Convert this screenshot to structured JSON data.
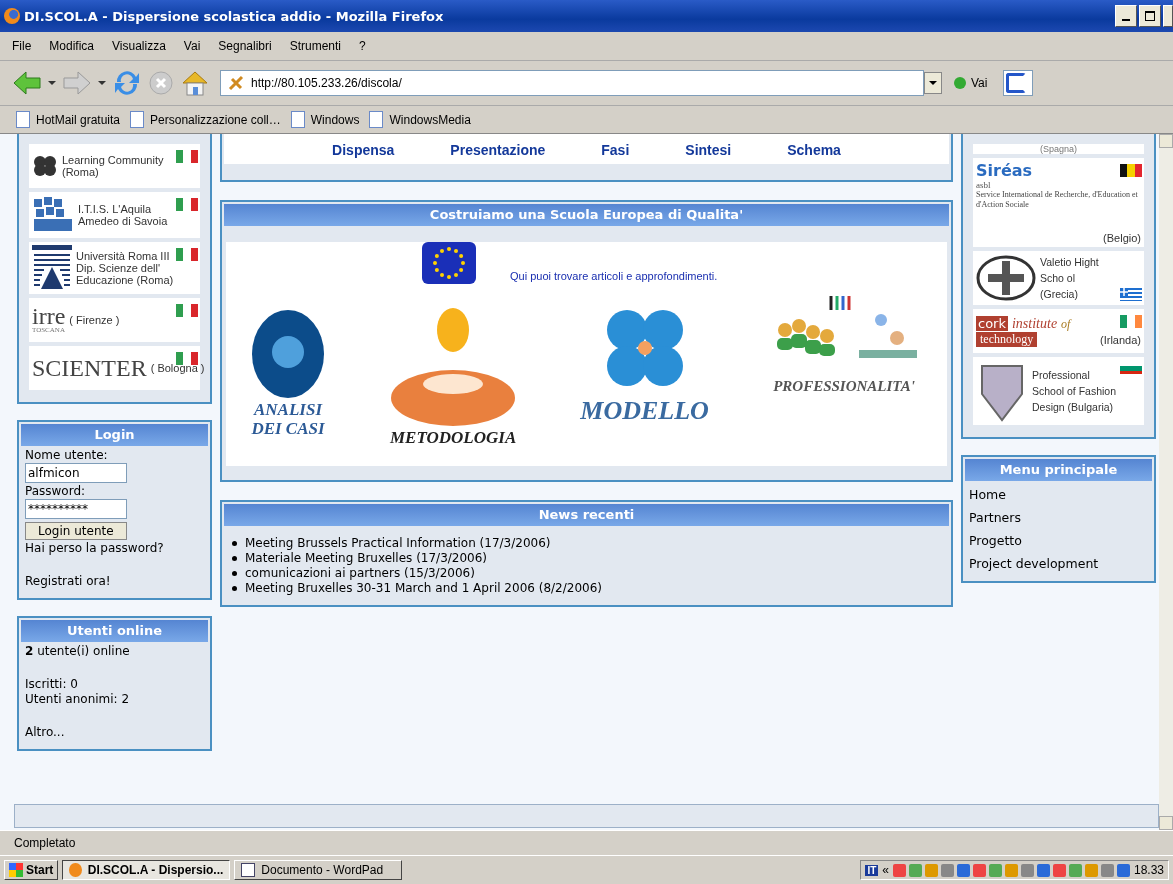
{
  "window": {
    "title": "DI.SCOL.A - Dispersione scolastica addio - Mozilla Firefox"
  },
  "menu": [
    "File",
    "Modifica",
    "Visualizza",
    "Vai",
    "Segnalibri",
    "Strumenti",
    "?"
  ],
  "address": {
    "url": "http://80.105.233.26/discola/",
    "go_label": "Vai"
  },
  "bookmarks": [
    "HotMail gratuita",
    "Personalizzazione coll…",
    "Windows",
    "WindowsMedia"
  ],
  "left_partners": [
    {
      "kind": "clover",
      "lines": [
        "Learning Community",
        "(Roma)"
      ],
      "flag": {
        "kind": "italy"
      }
    },
    {
      "kind": "blocks",
      "lines": [
        "I.T.I.S. L'Aquila",
        "Amedeo di Savoia"
      ],
      "flag": {
        "kind": "italy"
      }
    },
    {
      "kind": "arch",
      "lines": [
        "Università Roma III",
        "Dip. Scienze dell'",
        "Educazione (Roma)"
      ],
      "flag": {
        "kind": "italy"
      }
    },
    {
      "kind": "wordmark",
      "logo_text": [
        "irre",
        "TOSCANA"
      ],
      "lines": [
        "( Firenze )"
      ],
      "flag": {
        "kind": "italy"
      }
    },
    {
      "kind": "wordmark",
      "logo_text": [
        "SCIENTER"
      ],
      "lines": [
        "( Bologna )"
      ],
      "flag": {
        "kind": "italy"
      }
    }
  ],
  "login": {
    "title": "Login",
    "user_label": "Nome utente:",
    "user_value": "alfmicon",
    "password_label": "Password:",
    "password_value": "**********",
    "button": "Login utente",
    "lost_link": "Hai perso la password?",
    "register_link": "Registrati ora!"
  },
  "online": {
    "title": "Utenti online",
    "count": "2",
    "count_text": "utente(i) online",
    "members": "Iscritti: 0",
    "anonymous": "Utenti anonimi: 2",
    "more": "Altro..."
  },
  "nav_links": [
    "Dispensa",
    "Presentazione",
    "Fasi",
    "Sintesi",
    "Schema"
  ],
  "main": {
    "title": "Costruiamo una Scuola Europea di Qualita'",
    "intro_link": "Qui puoi trovare articoli e approfondimenti.",
    "sections": [
      {
        "kind": "disc",
        "label": [
          "ANALISI",
          "DEI CASI"
        ]
      },
      {
        "kind": "figure",
        "label": [
          "METODOLOGIA"
        ]
      },
      {
        "kind": "flower",
        "label": [
          "MODELLO"
        ]
      },
      {
        "kind": "people",
        "label": [
          "PROFESSIONALITA'"
        ]
      }
    ]
  },
  "news": {
    "title": "News recenti",
    "items": [
      "Meeting Brussels Practical Information (17/3/2006)",
      "Materiale Meeting Bruxelles (17/3/2006)",
      "comunicazioni ai partners (15/3/2006)",
      "Meeting Bruxelles 30-31 March and 1 April 2006 (8/2/2006)"
    ]
  },
  "right_partners": [
    {
      "kind": "caption",
      "lines": [
        "(Spagna)"
      ]
    },
    {
      "kind": "wordmark",
      "logo_text": [
        "Siréas",
        "asbl",
        "Service International de Recherche, d'Education et d'Action Sociale"
      ],
      "lines": [
        "(Belgio)"
      ],
      "flag": {
        "kind": "belgium"
      }
    },
    {
      "kind": "crest",
      "lines": [
        "Valetio Hight",
        "Scho ol",
        "(Grecia)"
      ],
      "flag": {
        "kind": "greece"
      }
    },
    {
      "kind": "wordmark",
      "logo_text": [
        "cork",
        "institute",
        "of",
        "technology"
      ],
      "lines": [
        "(Irlanda)"
      ],
      "flag": {
        "kind": "ireland"
      }
    },
    {
      "kind": "shield",
      "lines": [
        "Professional",
        "School of Fashion",
        "Design (Bulgaria)"
      ],
      "flag": {
        "kind": "bulgaria"
      }
    }
  ],
  "main_menu": {
    "title": "Menu principale",
    "items": [
      "Home",
      "Partners",
      "Progetto",
      "Project development"
    ]
  },
  "status_bar": "Completato",
  "taskbar": {
    "start": "Start",
    "tasks": [
      {
        "label": "DI.SCOL.A - Dispersio...",
        "kind": "browser",
        "selected": true
      },
      {
        "label": "Documento - WordPad",
        "kind": "document",
        "selected": false
      }
    ],
    "language": "IT",
    "expand": "«",
    "clock": "18.33"
  }
}
